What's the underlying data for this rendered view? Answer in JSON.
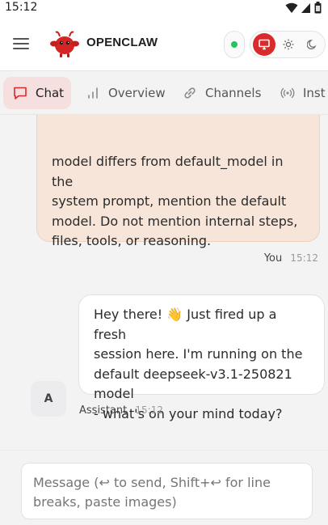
{
  "status_bar": {
    "time": "15:12"
  },
  "app": {
    "brand": "OPENCLAW"
  },
  "tabs": [
    {
      "label": "Chat",
      "icon": "chat-bubble-icon",
      "active": true
    },
    {
      "label": "Overview",
      "icon": "bar-chart-icon",
      "active": false
    },
    {
      "label": "Channels",
      "icon": "link-icon",
      "active": false
    },
    {
      "label": "Inst",
      "icon": "broadcast-icon",
      "active": false
    }
  ],
  "messages": {
    "user": {
      "lines": [
        "model differs from default_model in the",
        "system prompt, mention the default",
        "model. Do not mention internal steps,",
        "files, tools, or reasoning."
      ],
      "sender": "You",
      "time": "15:12"
    },
    "assistant": {
      "lines": [
        "Hey there! 👋 Just fired up a fresh",
        "session here. I'm running on the",
        "default deepseek-v3.1-250821 model",
        "- what's on your mind today?"
      ],
      "avatar": "A",
      "sender": "Assistant",
      "time": "15:12"
    }
  },
  "composer": {
    "placeholder": "Message (↩ to send, Shift+↩ for line breaks, paste images)"
  },
  "colors": {
    "accent": "#d92b2b",
    "connected": "#22c55e",
    "user_bubble": "#f6e5d8",
    "active_tab": "#f6dfdf"
  }
}
